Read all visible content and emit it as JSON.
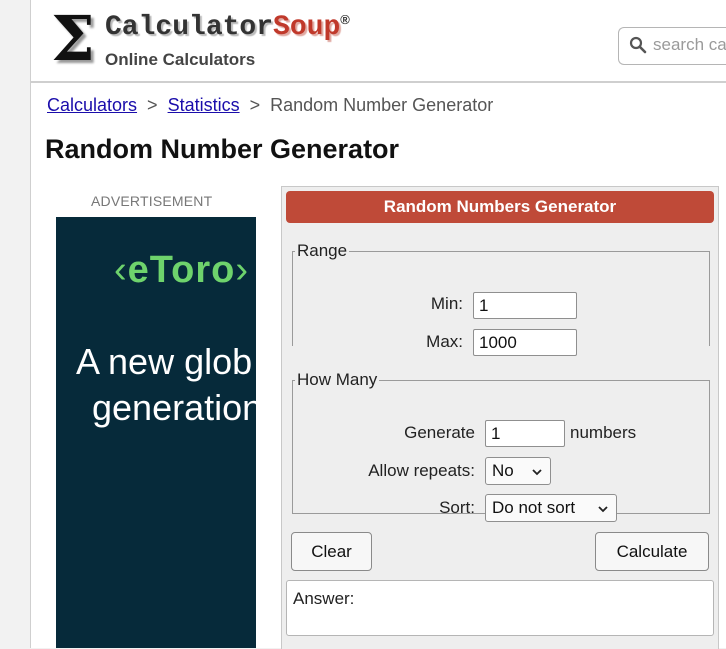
{
  "header": {
    "logo_sigma": "Σ",
    "logo_calc": "Calculator",
    "logo_soup": "Soup",
    "logo_reg": "®",
    "logo_subtitle": "Online Calculators",
    "search_placeholder": "search calculators"
  },
  "breadcrumb": {
    "items": [
      "Calculators",
      "Statistics",
      "Random Number Generator"
    ],
    "separator": ">"
  },
  "page_title": "Random Number Generator",
  "ad": {
    "label": "ADVERTISEMENT",
    "brand": "eToro",
    "text_line1": "A new glob",
    "text_line2": "generation"
  },
  "calculator": {
    "title": "Random Numbers Generator",
    "range": {
      "legend": "Range",
      "min_label": "Min:",
      "min_value": "1",
      "max_label": "Max:",
      "max_value": "1000"
    },
    "how_many": {
      "legend": "How Many",
      "generate_label": "Generate",
      "generate_value": "1",
      "generate_suffix": "numbers",
      "repeats_label": "Allow repeats:",
      "repeats_value": "No",
      "sort_label": "Sort:",
      "sort_value": "Do not sort"
    },
    "clear_label": "Clear",
    "calculate_label": "Calculate",
    "answer_label": "Answer:"
  },
  "colors": {
    "accent": "#bf4a38",
    "link": "#1a0dab",
    "ad_background": "#062a3a",
    "ad_brand": "#6ed36c"
  }
}
